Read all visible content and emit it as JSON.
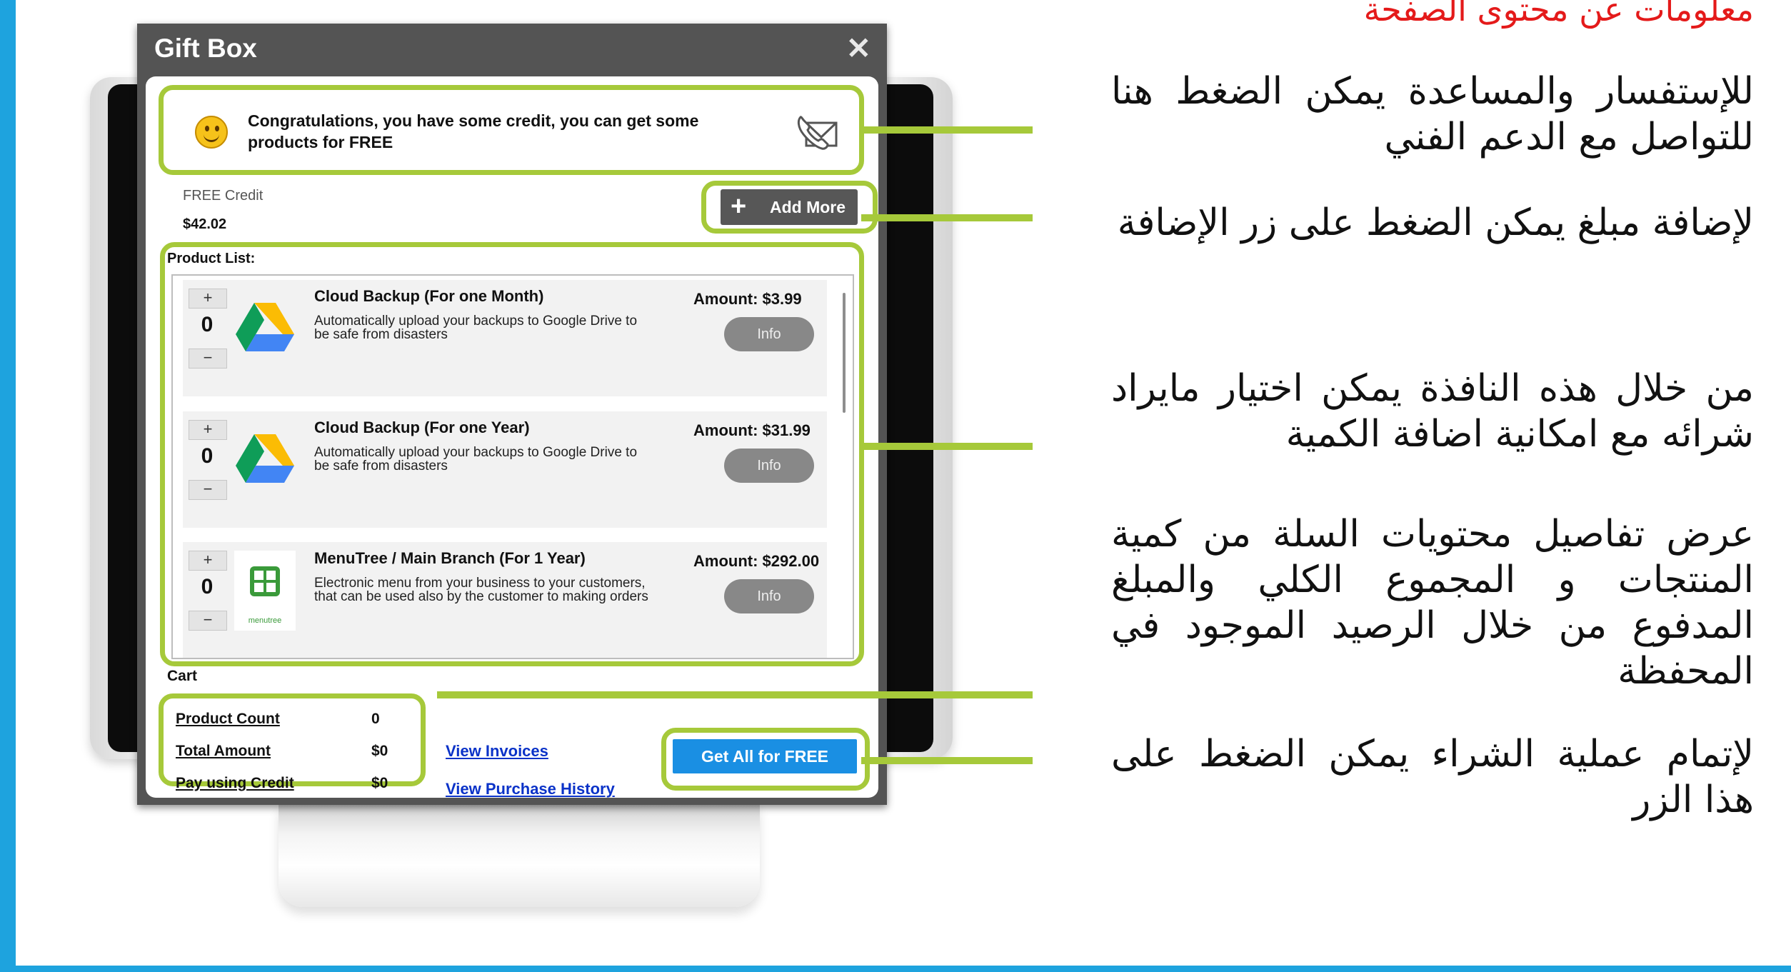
{
  "dialog": {
    "title": "Gift Box",
    "close_glyph": "✕",
    "congrats_text": "Congratulations, you have some credit, you can get some products for FREE",
    "smiley_icon": "smiley-icon",
    "support_icon": "phone-envelope-icon",
    "credit_label": "FREE Credit",
    "credit_value": "$42.02",
    "add_more_label": "Add More",
    "product_list_label": "Product List:",
    "products": [
      {
        "name": "Cloud Backup (For one Month)",
        "description": "Automatically upload your backups to Google Drive to be safe from disasters",
        "amount": "Amount: $3.99",
        "quantity": "0",
        "icon": "google-drive-icon"
      },
      {
        "name": "Cloud Backup (For one Year)",
        "description": "Automatically upload your backups to Google Drive to be safe from disasters",
        "amount": "Amount: $31.99",
        "quantity": "0",
        "icon": "google-drive-icon"
      },
      {
        "name": "MenuTree / Main Branch (For 1 Year)",
        "description": "Electronic menu from your business to your customers, that can be used also by the customer to making orders",
        "amount": "Amount: $292.00",
        "quantity": "0",
        "icon": "menutree-logo",
        "logo_text": "menutree"
      }
    ],
    "qty_plus": "+",
    "qty_minus": "−",
    "info_label": "Info",
    "cart": {
      "label": "Cart",
      "product_count_label": "Product Count",
      "product_count": "0",
      "total_amount_label": "Total Amount",
      "total_amount": "$0",
      "pay_credit_label": "Pay using Credit",
      "pay_credit": "$0"
    },
    "view_invoices": "View Invoices",
    "view_purchase_history": "View Purchase History",
    "get_all_label": "Get All for FREE"
  },
  "annotations": {
    "title": "معلومات عن محتوى الصفحة",
    "items": [
      "للإستفسار والمساعدة يمكن الضغط هنا للتواصل مع الدعم الفني",
      "لإضافة مبلغ يمكن الضغط على زر الإضافة",
      "من خلال هذه النافذة يمكن اختيار مايراد شرائه مع امكانية اضافة الكمية",
      "عرض تفاصيل محتويات السلة من كمية المنتجات و المجموع الكلي والمبلغ المدفوع من خلال الرصيد الموجود في المحفظة",
      "لإتمام عملية الشراء يمكن الضغط على هذا الزر"
    ]
  },
  "colors": {
    "frame_blue": "#1ea3de",
    "highlight_green": "#a6c93a",
    "title_red": "#e41a1a",
    "button_blue": "#1a8fe3",
    "link_blue": "#0a32c8"
  }
}
